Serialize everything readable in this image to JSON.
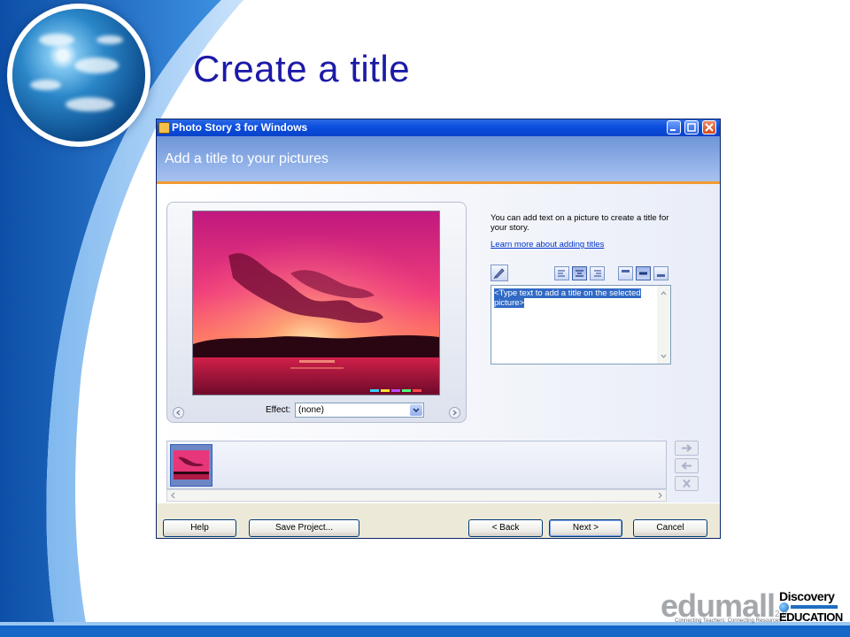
{
  "slide": {
    "title": "Create a title"
  },
  "window": {
    "title": "Photo Story 3 for Windows",
    "header": "Add a title to your pictures"
  },
  "preview": {
    "effect_label": "Effect:",
    "effect_value": "(none)"
  },
  "panel": {
    "help_text": "You can add text on a picture to create a title for your story.",
    "learn_link": "Learn more about adding titles",
    "title_text": "<Type text to add a title on the selected picture>"
  },
  "buttons": {
    "help": "Help",
    "save_project": "Save Project...",
    "back": "< Back",
    "next": "Next >",
    "cancel": "Cancel"
  },
  "branding": {
    "edumall": "edumall",
    "edumall_version": "2.0",
    "edumall_tagline": "Connecting Teachers: Connecting Resources",
    "discovery": "Discovery",
    "education": "EDUCATION"
  },
  "icons": {
    "app": "photo-story-app-icon",
    "font": "font-pencil-icon",
    "align_left": "align-left-icon",
    "align_center": "align-center-icon",
    "align_right": "align-right-icon",
    "position_top": "position-top-icon",
    "position_middle": "position-middle-icon",
    "position_bottom": "position-bottom-icon",
    "move_right": "arrow-right-icon",
    "move_left": "arrow-left-icon",
    "remove": "x-icon"
  },
  "colors": {
    "slide_title": "#1c1aa8",
    "title_bar": "#0a4ee0",
    "header_accent": "#f39b32",
    "selection": "#316ac5",
    "link": "#0033cc"
  }
}
